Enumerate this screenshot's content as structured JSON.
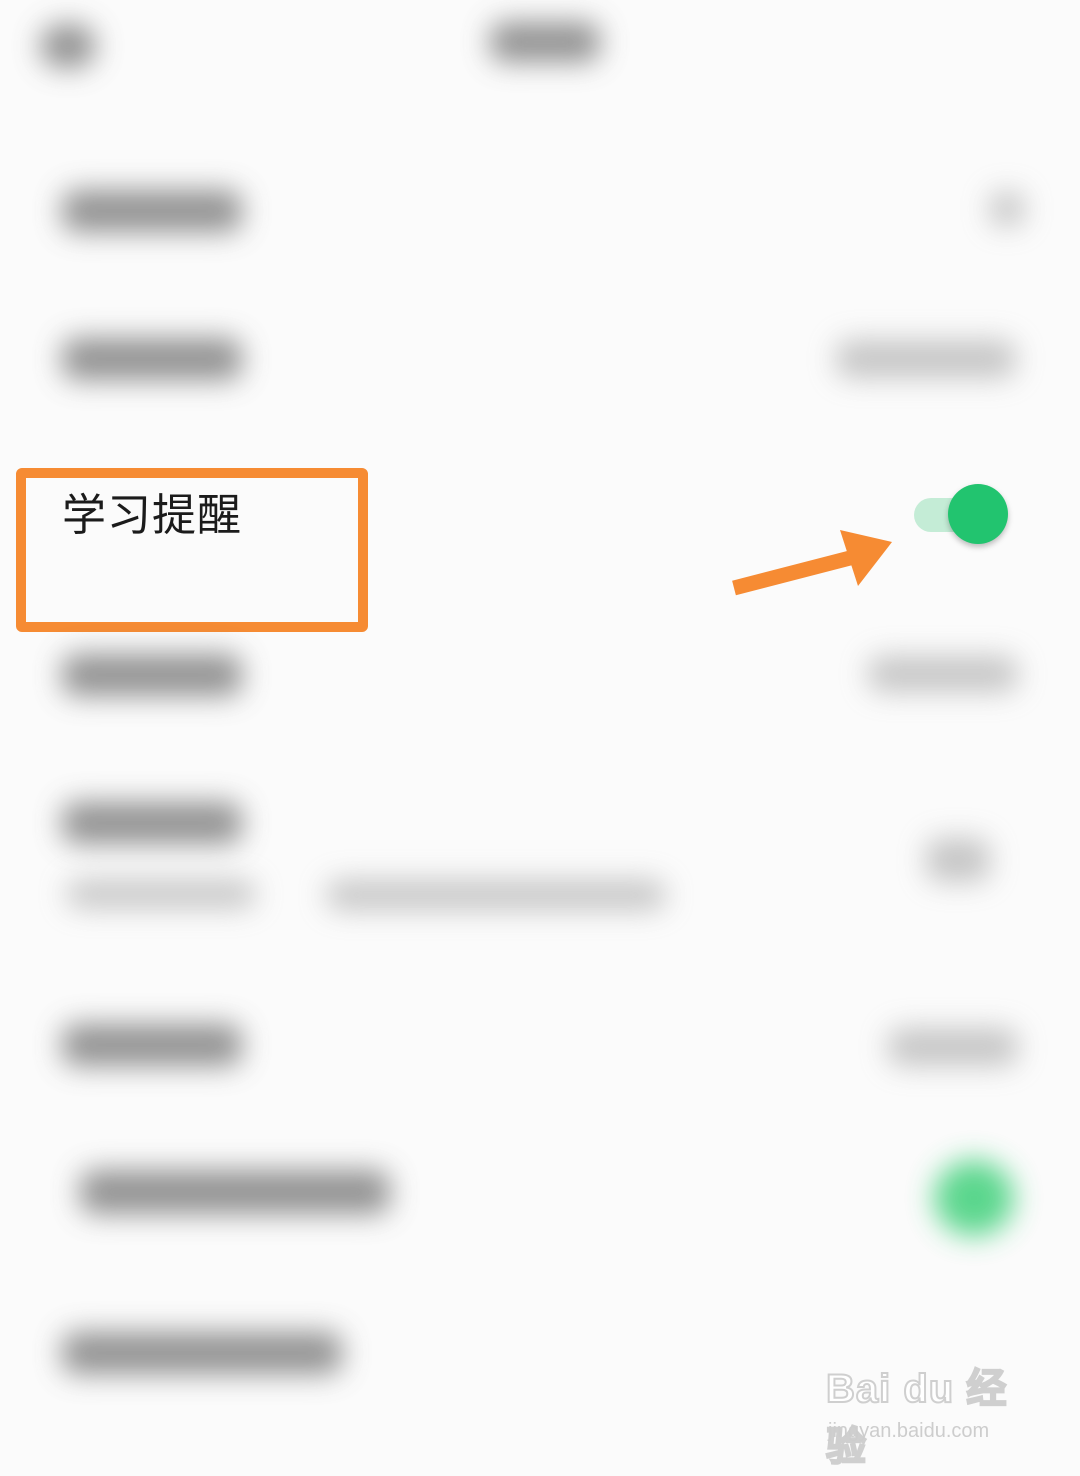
{
  "settings": {
    "study_reminder": {
      "label": "学习提醒",
      "enabled": true
    },
    "toggle_color": "#22c46f"
  },
  "annotation": {
    "highlight_color": "#f68b33",
    "arrow_color": "#f68b33"
  },
  "watermark": {
    "brand": "Bai du 经验",
    "url": "jingyan.baidu.com"
  }
}
